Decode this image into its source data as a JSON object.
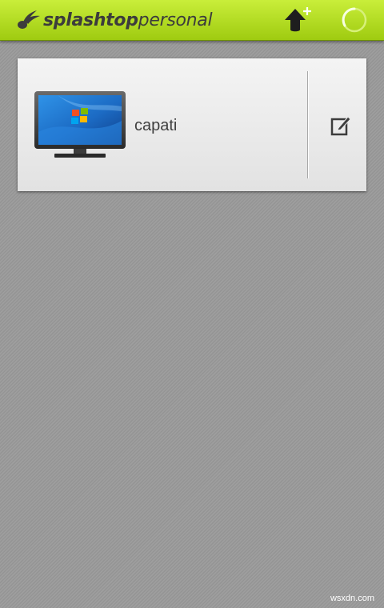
{
  "app": {
    "logo_bold": "splashtop",
    "logo_light": "personal"
  },
  "toolbar": {
    "add_icon": "add-computer-icon",
    "refresh_icon": "refresh-spinner-icon"
  },
  "computers": [
    {
      "name": "capati",
      "icon": "windows-monitor-icon",
      "edit_icon": "edit-icon"
    }
  ],
  "watermark": "wsxdn.com",
  "colors": {
    "topbar": "#b5de24",
    "background": "#9a9a9a",
    "card": "#ececec",
    "text": "#3f3f3f"
  }
}
